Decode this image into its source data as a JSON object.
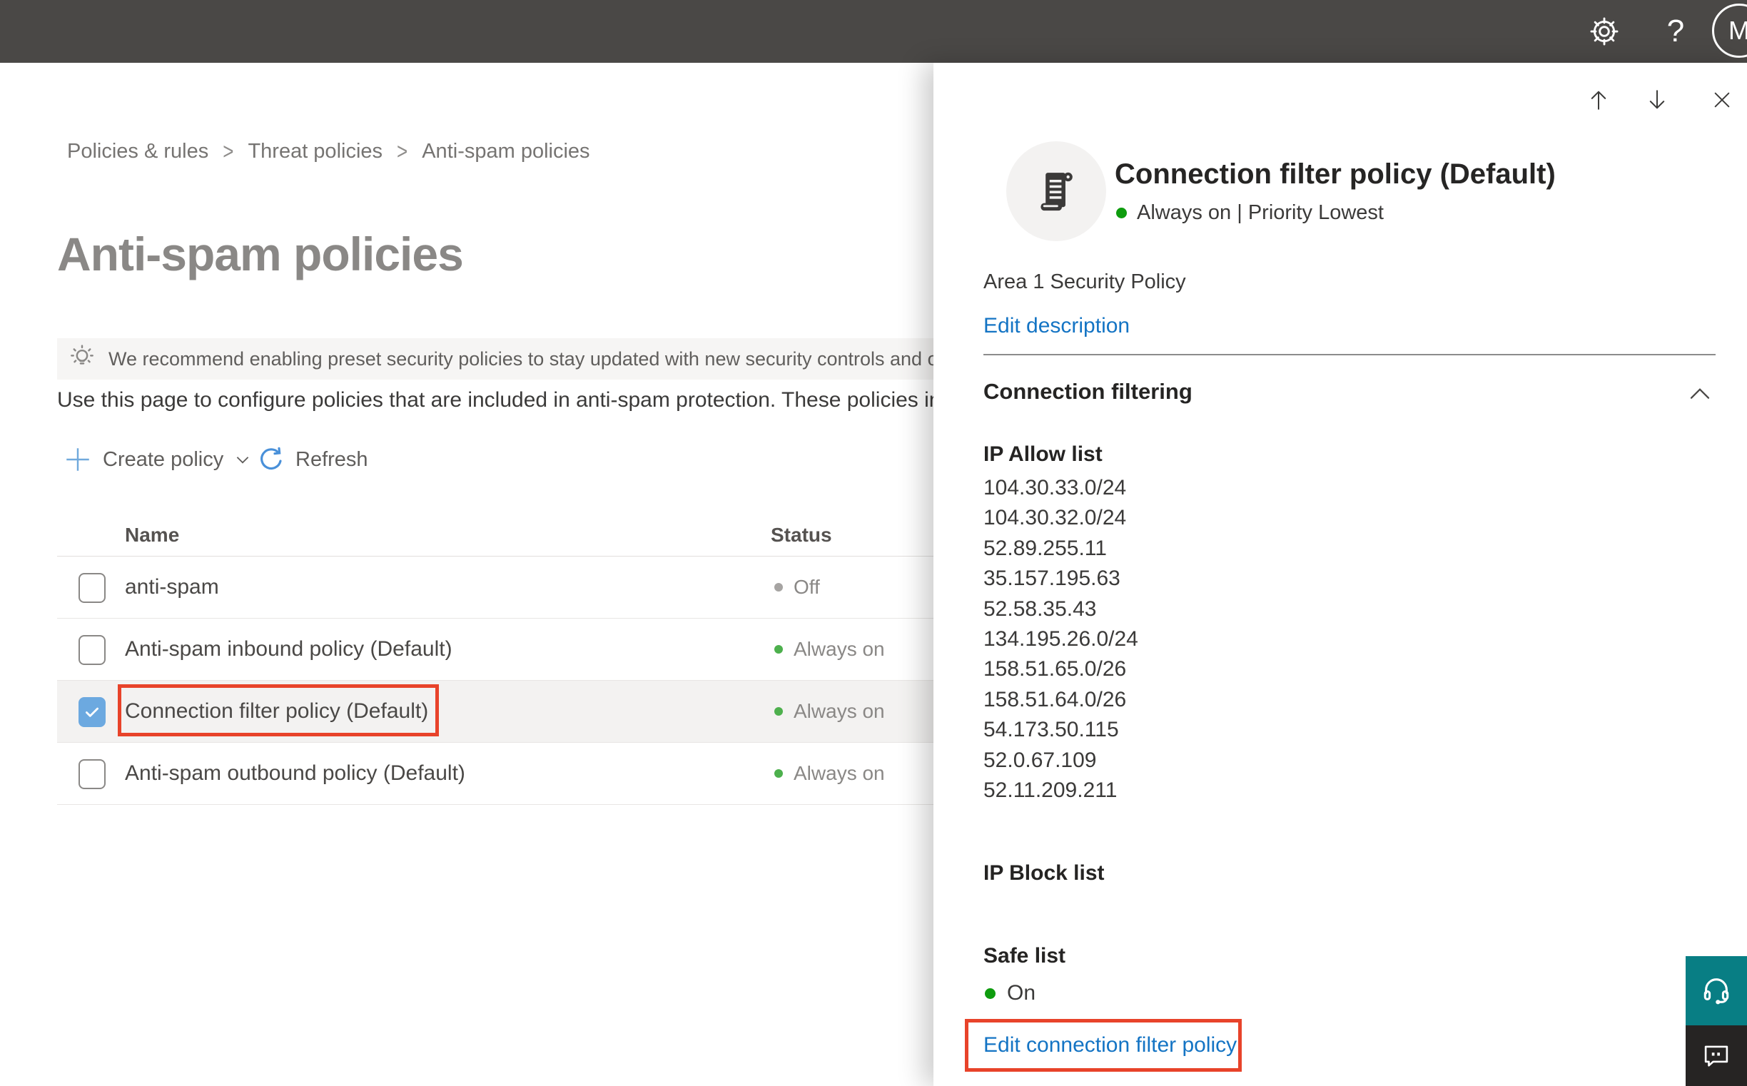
{
  "colors": {
    "topbar_bg": "#4a4846",
    "annotation_red": "#e8432a",
    "link_blue": "#1474c4",
    "checkbox_checked_blue": "#6ca9e0",
    "selected_row_bg": "#f3f2f1",
    "status_green_row": "#4db04d",
    "status_green_panel": "#0e9c0e",
    "status_gray_off": "#a6a4a2",
    "help_teal": "#087e84",
    "feedback_dark": "#262423"
  },
  "topbar": {
    "help_glyph": "?",
    "avatar_initial": "M"
  },
  "breadcrumb": {
    "separator": ">",
    "items": [
      "Policies & rules",
      "Threat policies",
      "Anti-spam policies"
    ]
  },
  "page": {
    "title": "Anti-spam policies",
    "banner_text": "We recommend enabling preset security policies to stay updated with new security controls and our recomme",
    "description": "Use this page to configure policies that are included in anti-spam protection. These policies include",
    "toolbar": {
      "create_policy_label": "Create policy",
      "refresh_label": "Refresh"
    }
  },
  "table": {
    "columns": [
      "Name",
      "Status"
    ],
    "rows": [
      {
        "name": "anti-spam",
        "status": "Off",
        "status_color": "#a6a4a2",
        "checked": false,
        "selected": false,
        "annotated": false
      },
      {
        "name": "Anti-spam inbound policy (Default)",
        "status": "Always on",
        "status_color": "#4db04d",
        "checked": false,
        "selected": false,
        "annotated": false
      },
      {
        "name": "Connection filter policy (Default)",
        "status": "Always on",
        "status_color": "#4db04d",
        "checked": true,
        "selected": true,
        "annotated": true
      },
      {
        "name": "Anti-spam outbound policy (Default)",
        "status": "Always on",
        "status_color": "#4db04d",
        "checked": false,
        "selected": false,
        "annotated": false
      }
    ]
  },
  "panel": {
    "title": "Connection filter policy (Default)",
    "status_line": "Always on | Priority Lowest",
    "description": "Area 1 Security Policy",
    "edit_description_label": "Edit description",
    "section": {
      "title": "Connection filtering",
      "ip_allow": {
        "label": "IP Allow list",
        "items": [
          "104.30.33.0/24",
          "104.30.32.0/24",
          "52.89.255.11",
          "35.157.195.63",
          "52.58.35.43",
          "134.195.26.0/24",
          "158.51.65.0/26",
          "158.51.64.0/26",
          "54.173.50.115",
          "52.0.67.109",
          "52.11.209.211"
        ]
      },
      "ip_block": {
        "label": "IP Block list"
      },
      "safe_list": {
        "label": "Safe list",
        "status": "On"
      },
      "edit_link_label": "Edit connection filter policy"
    }
  }
}
